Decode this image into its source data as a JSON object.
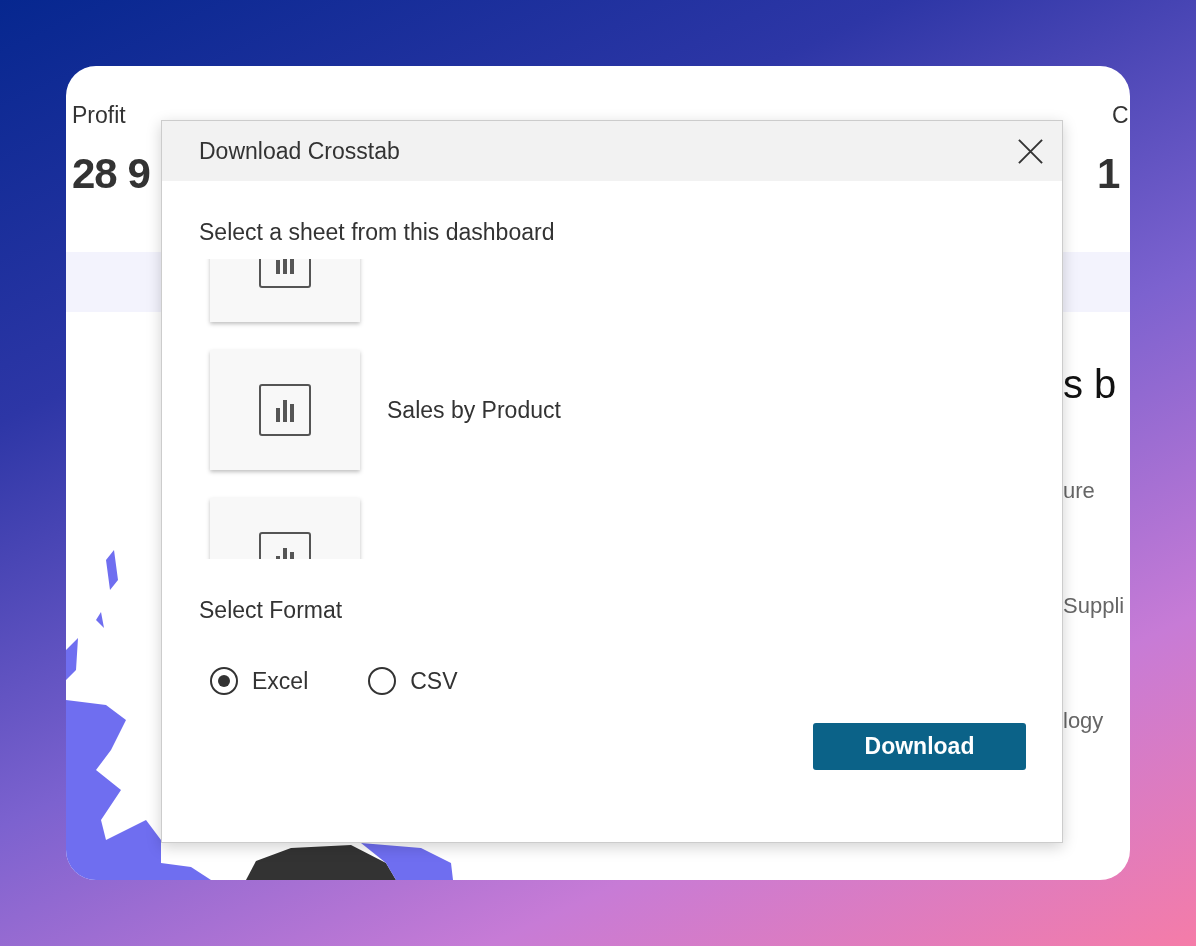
{
  "dashboard": {
    "kpis": [
      {
        "label": "Profit",
        "value": "28 9"
      },
      {
        "label": "C",
        "value": "1"
      }
    ],
    "heading": "s b",
    "categories": [
      "ure",
      "Suppli",
      "logy"
    ]
  },
  "dialog": {
    "title": "Download Crosstab",
    "sheet_prompt": "Select a sheet from this dashboard",
    "sheets": [
      {
        "kind": "thumbnail"
      },
      {
        "kind": "named",
        "name": "Sales by Product"
      },
      {
        "kind": "thumbnail"
      }
    ],
    "format_prompt": "Select Format",
    "formats": [
      {
        "label": "Excel",
        "selected": true
      },
      {
        "label": "CSV",
        "selected": false
      }
    ],
    "button": "Download"
  }
}
